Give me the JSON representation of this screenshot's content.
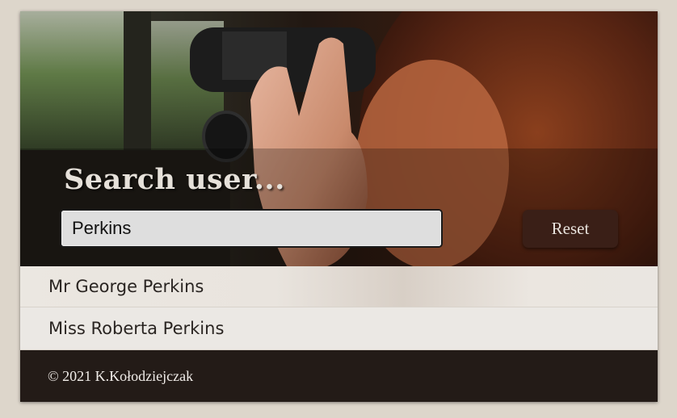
{
  "hero": {
    "title": "Search user..."
  },
  "search": {
    "value": "Perkins",
    "placeholder": ""
  },
  "reset_button": {
    "label": "Reset"
  },
  "results": [
    {
      "name": "Mr George Perkins"
    },
    {
      "name": "Miss Roberta Perkins"
    }
  ],
  "footer": {
    "copyright": "© 2021 K.Kołodziejczak"
  },
  "colors": {
    "page_background": "#ddd6cb",
    "footer_background": "#231b17",
    "button_background": "#3a1f17",
    "result_background": "#ebe8e4"
  }
}
